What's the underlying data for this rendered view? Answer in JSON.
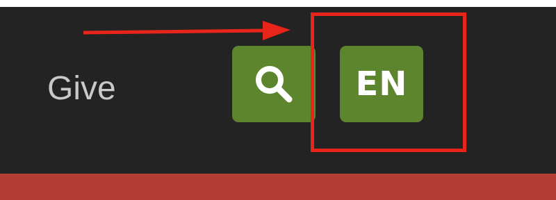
{
  "navbar": {
    "link_give": "Give",
    "search_icon": "search-icon",
    "language_label": "EN"
  },
  "annotations": {
    "arrow": "arrow-right",
    "highlight": "highlight-box"
  },
  "colors": {
    "navbar_bg": "#232323",
    "button_green": "#5d852e",
    "accent_red_bar": "#b33c35",
    "annotation_red": "#e8251b",
    "link_text": "#c9c9c9"
  }
}
